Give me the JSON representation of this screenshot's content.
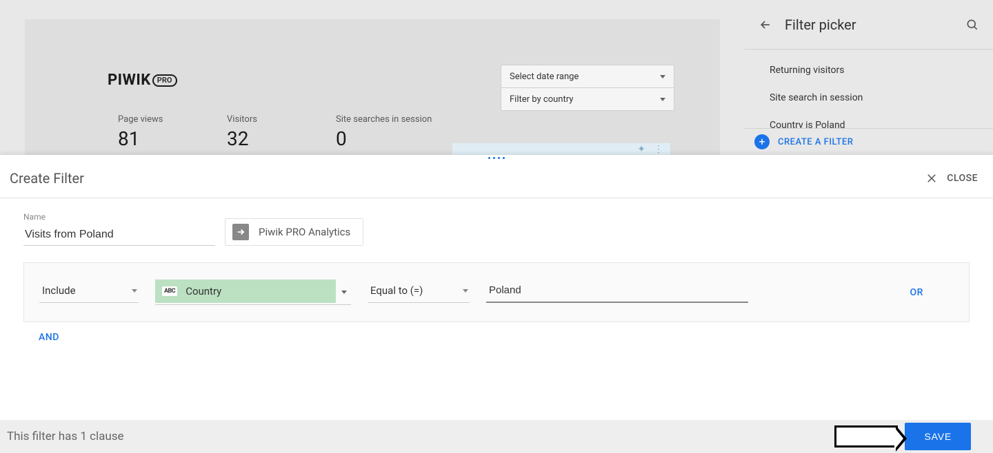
{
  "dashboard": {
    "logo_text": "PIWIK",
    "logo_pill": "PRO",
    "date_range_label": "Select date range",
    "country_filter_label": "Filter by country",
    "stats": [
      {
        "label": "Page views",
        "value": "81"
      },
      {
        "label": "Visitors",
        "value": "32"
      },
      {
        "label": "Site searches in session",
        "value": "0"
      }
    ]
  },
  "sidebar": {
    "title": "Filter picker",
    "items": [
      {
        "label": "Returning visitors"
      },
      {
        "label": "Site search in session"
      },
      {
        "label": "Country is Poland"
      }
    ],
    "create_label": "CREATE A FILTER"
  },
  "panel": {
    "title": "Create Filter",
    "close_label": "CLOSE",
    "name_label": "Name",
    "name_value": "Visits from Poland",
    "source_label": "Piwik PRO Analytics",
    "condition": {
      "mode": "Include",
      "dimension_badge": "ABC",
      "dimension": "Country",
      "operator": "Equal to (=)",
      "value": "Poland"
    },
    "or_label": "OR",
    "and_label": "AND"
  },
  "footer": {
    "status": "This filter has 1 clause",
    "save_label": "SAVE"
  }
}
